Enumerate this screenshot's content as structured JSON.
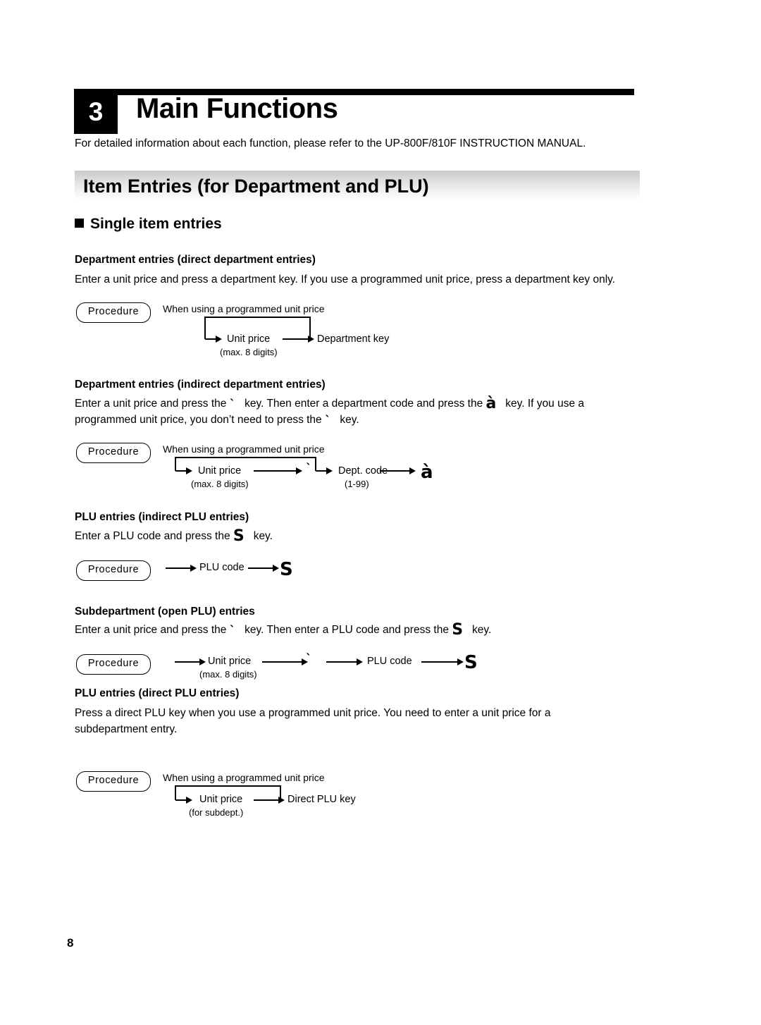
{
  "chapter": {
    "number": "3",
    "title": "Main Functions",
    "intro": "For detailed information about each function, please refer to the UP-800F/810F INSTRUCTION MANUAL."
  },
  "section": {
    "title": "Item Entries (for Department and PLU)",
    "subhead": "Single item entries"
  },
  "common": {
    "procedure_label": "Procedure",
    "programmed_note": "When using a programmed unit price",
    "unit_price": "Unit price",
    "max8": "(max. 8 digits)",
    "plu_code": "PLU code",
    "key_price": "`",
    "key_dept": "à",
    "key_plu": "S"
  },
  "blocks": [
    {
      "id": "dept-direct",
      "title": "Department entries (direct department entries)",
      "body": "Enter a unit price and press a department key. If you use a programmed unit price, press a department key only.",
      "diagram": {
        "note": "When using a programmed unit price",
        "unit_price": "Unit price",
        "max8": "(max. 8 digits)",
        "dept_key": "Department key"
      }
    },
    {
      "id": "dept-indirect",
      "title": "Department entries (indirect department entries)",
      "body_1": "Enter a unit price and press the",
      "body_2": "key. Then enter a department code and press the",
      "body_3": "key. If you use a",
      "body_4": "programmed unit price, you don’t need to press the",
      "body_5": "key.",
      "diagram": {
        "note": "When using a programmed unit price",
        "unit_price": "Unit price",
        "max8": "(max. 8 digits)",
        "dept_code": "Dept. code",
        "range": "(1-99)"
      }
    },
    {
      "id": "plu-indirect",
      "title": "PLU entries (indirect PLU entries)",
      "body_1": "Enter a PLU code and press the",
      "body_2": "key.",
      "diagram": {
        "plu_code": "PLU code"
      }
    },
    {
      "id": "subdept",
      "title": "Subdepartment (open PLU) entries",
      "body_1": "Enter a unit price and press the",
      "body_2": "key. Then enter a PLU code and press the",
      "body_3": "key.",
      "diagram": {
        "unit_price": "Unit price",
        "max8": "(max. 8 digits)",
        "plu_code": "PLU code"
      }
    },
    {
      "id": "plu-direct",
      "title": "PLU entries (direct PLU entries)",
      "body_1": "Press a direct PLU key when you use a programmed unit price. You need to enter a unit price for a",
      "body_2": "subdepartment entry.",
      "diagram": {
        "note": "When using a programmed unit price",
        "unit_price": "Unit price",
        "for_subdept": "(for subdept.)",
        "direct_plu_key": "Direct PLU key"
      }
    }
  ],
  "footer": {
    "page_number": "8"
  }
}
